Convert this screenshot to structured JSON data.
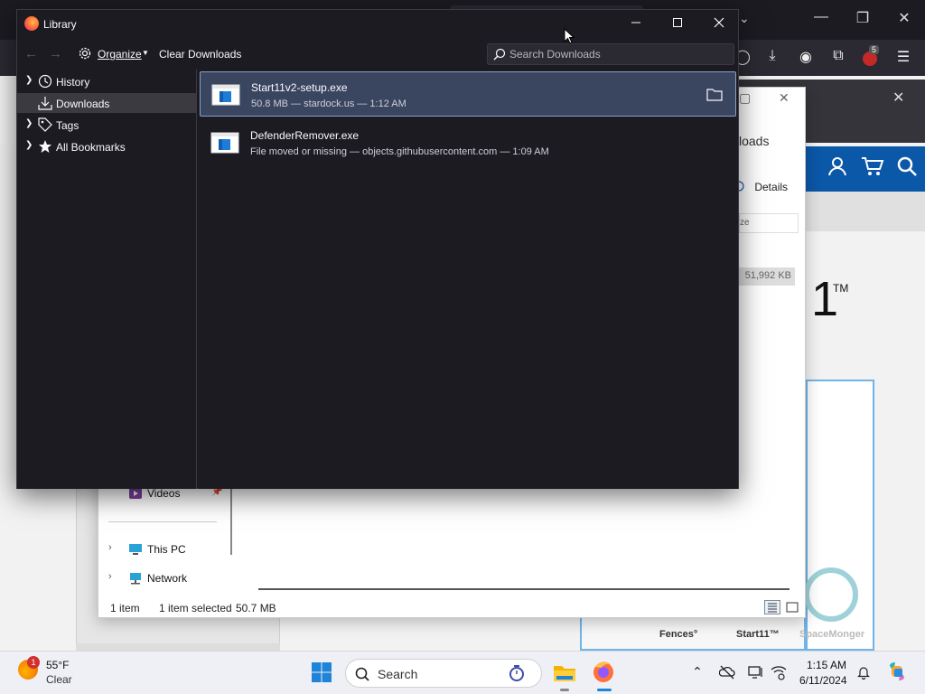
{
  "library": {
    "title": "Library",
    "toolbar": {
      "organize_label": "Organize",
      "clear_downloads_label": "Clear Downloads",
      "search_placeholder": "Search Downloads"
    },
    "sidebar": {
      "items": [
        {
          "label": "History",
          "icon": "history-clock-icon",
          "has_twisty": true,
          "selected": false
        },
        {
          "label": "Downloads",
          "icon": "download-arrow-icon",
          "has_twisty": false,
          "selected": true
        },
        {
          "label": "Tags",
          "icon": "tag-icon",
          "has_twisty": true,
          "selected": false
        },
        {
          "label": "All Bookmarks",
          "icon": "star-icon",
          "has_twisty": true,
          "selected": false
        }
      ]
    },
    "downloads": [
      {
        "name": "Start11v2-setup.exe",
        "status": "50.8 MB — stardock.us — 1:12 AM",
        "selected": true
      },
      {
        "name": "DefenderRemover.exe",
        "status": "File moved or missing — objects.githubusercontent.com — 1:09 AM",
        "selected": false
      }
    ]
  },
  "explorer": {
    "partial_header": "loads",
    "details_label": "Details",
    "column_partial": "ze",
    "file_size": "51,992 KB",
    "nav": [
      {
        "label": "Videos",
        "icon": "videos-icon"
      },
      {
        "label": "This PC",
        "icon": "this-pc-icon"
      },
      {
        "label": "Network",
        "icon": "network-icon"
      }
    ],
    "status": {
      "count": "1 item",
      "selected": "1 item selected",
      "size": "50.7 MB"
    }
  },
  "background_site": {
    "big_glyph": "1",
    "trademark": "TM",
    "cards": [
      "Fences°",
      "Start11™",
      "SpaceMonger"
    ],
    "extension_badge": "5"
  },
  "taskbar": {
    "weather": {
      "temp": "55°F",
      "desc": "Clear",
      "badge": "1"
    },
    "search_label": "Search",
    "clock": {
      "time": "1:15 AM",
      "date": "6/11/2024"
    }
  },
  "colors": {
    "library_bg": "#1c1b22",
    "selected_row": "#3a4560",
    "taskbar_bg": "#eef0f5",
    "site_blue": "#0b57a8"
  }
}
